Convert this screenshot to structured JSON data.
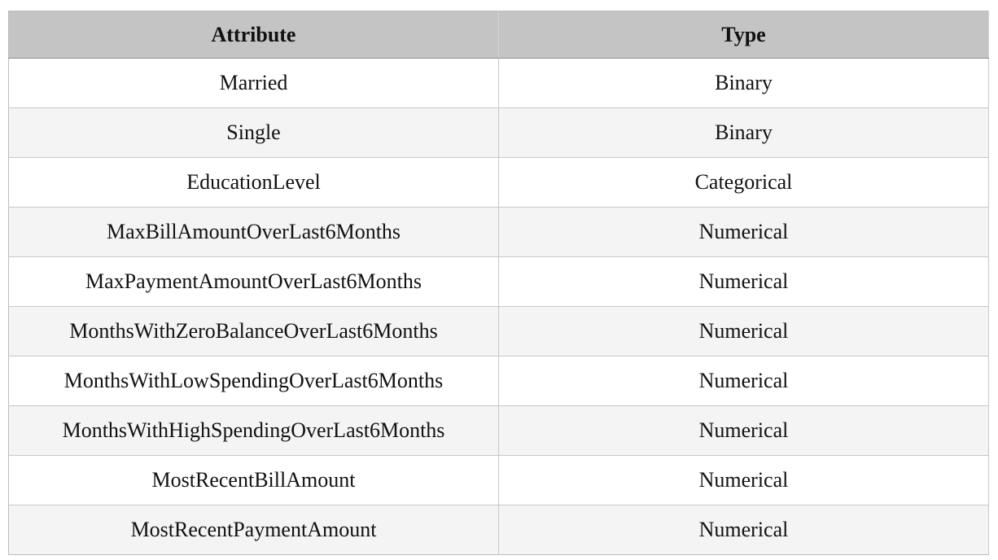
{
  "table": {
    "headers": [
      "Attribute",
      "Type"
    ],
    "rows": [
      {
        "attribute": "Married",
        "type": "Binary"
      },
      {
        "attribute": "Single",
        "type": "Binary"
      },
      {
        "attribute": "EducationLevel",
        "type": "Categorical"
      },
      {
        "attribute": "MaxBillAmountOverLast6Months",
        "type": "Numerical"
      },
      {
        "attribute": "MaxPaymentAmountOverLast6Months",
        "type": "Numerical"
      },
      {
        "attribute": "MonthsWithZeroBalanceOverLast6Months",
        "type": "Numerical"
      },
      {
        "attribute": "MonthsWithLowSpendingOverLast6Months",
        "type": "Numerical"
      },
      {
        "attribute": "MonthsWithHighSpendingOverLast6Months",
        "type": "Numerical"
      },
      {
        "attribute": "MostRecentBillAmount",
        "type": "Numerical"
      },
      {
        "attribute": "MostRecentPaymentAmount",
        "type": "Numerical"
      }
    ]
  },
  "colors": {
    "header_bg": "#c3c4c3",
    "row_alt_bg": "#f4f4f4",
    "row_bg": "#ffffff",
    "border": "#c8c8c8"
  }
}
